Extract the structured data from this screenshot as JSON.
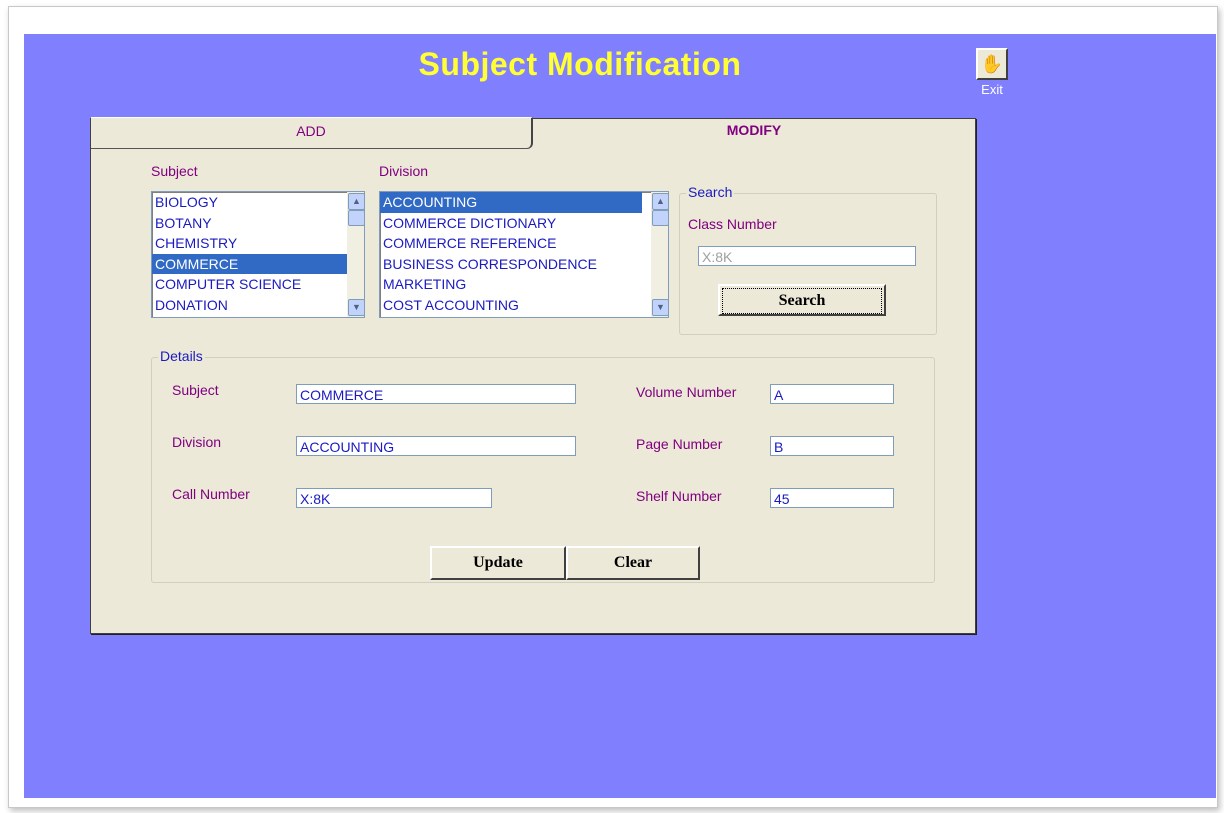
{
  "window": {
    "title": "Subject Modification"
  },
  "exit": {
    "label": "Exit",
    "icon": "hand-icon"
  },
  "tabs": [
    {
      "label": "ADD"
    },
    {
      "label": "MODIFY"
    }
  ],
  "subject_list": {
    "label": "Subject",
    "items": [
      "BIOLOGY",
      "BOTANY",
      "CHEMISTRY",
      "COMMERCE",
      "COMPUTER SCIENCE",
      "DONATION"
    ],
    "selected": "COMMERCE"
  },
  "division_list": {
    "label": "Division",
    "items": [
      "ACCOUNTING",
      "COMMERCE DICTIONARY",
      "COMMERCE REFERENCE",
      "BUSINESS CORRESPONDENCE",
      "MARKETING",
      "COST ACCOUNTING"
    ],
    "selected": "ACCOUNTING"
  },
  "search": {
    "group_label": "Search",
    "class_number_label": "Class Number",
    "class_number_value": "X:8K",
    "button_label": "Search"
  },
  "details": {
    "group_label": "Details",
    "subject_label": "Subject",
    "subject_value": "COMMERCE",
    "division_label": "Division",
    "division_value": "ACCOUNTING",
    "call_number_label": "Call Number",
    "call_number_value": "X:8K",
    "volume_label": "Volume Number",
    "volume_value": "A",
    "page_label": "Page Number",
    "page_value": "B",
    "shelf_label": "Shelf Number",
    "shelf_value": "45"
  },
  "buttons": {
    "update": "Update",
    "clear": "Clear"
  },
  "colors": {
    "background": "#8080ff",
    "title": "#ffff33",
    "label": "#800080",
    "value": "#1a1ac0",
    "selection": "#316ac5"
  }
}
